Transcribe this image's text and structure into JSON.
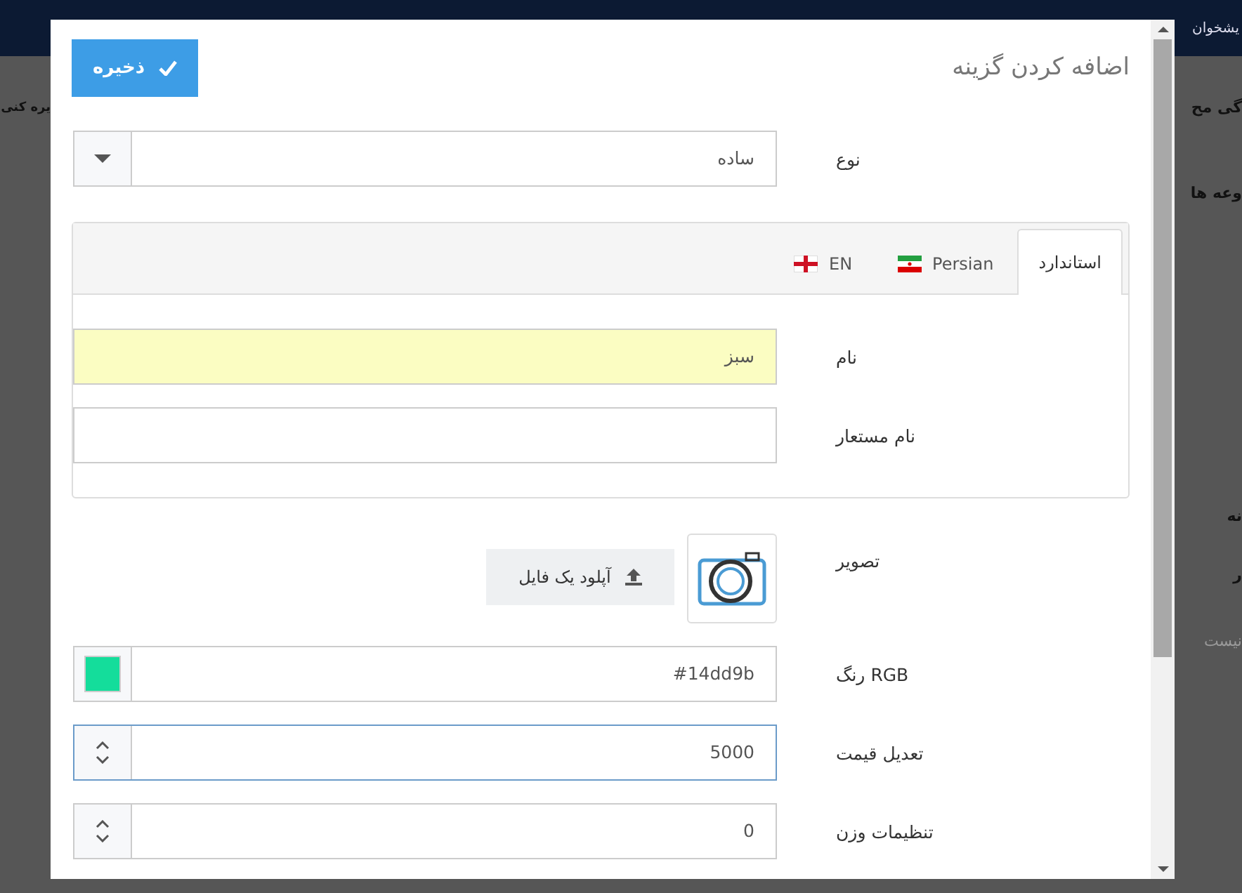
{
  "background": {
    "nav_label": "یشخوان",
    "left_texts": [
      "یره کنی"
    ],
    "right_texts": [
      {
        "text": "گی مح",
        "muted": false
      },
      {
        "text": "وعه ها",
        "muted": false
      },
      {
        "text": "نه",
        "muted": false
      },
      {
        "text": "ر",
        "muted": false
      },
      {
        "text": "نیست",
        "muted": true
      }
    ]
  },
  "modal": {
    "title": "اضافه کردن گزینه",
    "save_button": "ذخیره",
    "type_field": {
      "label": "نوع",
      "value": "ساده"
    },
    "tabs": [
      {
        "label": "استاندارد",
        "kind": "plain",
        "selected": true
      },
      {
        "label": "Persian",
        "kind": "iran",
        "selected": false
      },
      {
        "label": "EN",
        "kind": "england",
        "selected": false
      }
    ],
    "tab_fields": [
      {
        "label": "نام",
        "value": "سبز",
        "highlighted": true
      },
      {
        "label": "نام مستعار",
        "highlighted": false
      }
    ],
    "image_field": {
      "label": "تصویر",
      "upload_button": "آپلود یک فایل"
    },
    "fields": [
      {
        "kind": "color",
        "label": "RGB رنگ",
        "value": "#14dd9b",
        "color": "#14dd9b",
        "focused": false
      },
      {
        "kind": "number",
        "label": "تعدیل قیمت",
        "value": "5000",
        "focused": true
      },
      {
        "kind": "number",
        "label": "تنظیمات وزن",
        "value": "0",
        "focused": false
      }
    ]
  }
}
